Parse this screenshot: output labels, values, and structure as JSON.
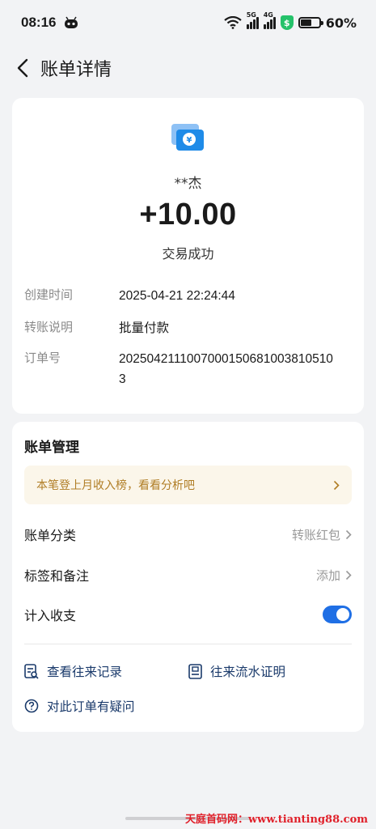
{
  "status_bar": {
    "time": "08:16",
    "sig1_tag": "5G",
    "sig2_tag": "4G",
    "battery_percent": "60%",
    "battery_level": 0.6
  },
  "nav": {
    "title": "账单详情"
  },
  "summary": {
    "icon": "transfer-bill-icon",
    "payee": "**杰",
    "amount": "+10.00",
    "status": "交易成功"
  },
  "details": [
    {
      "label": "创建时间",
      "value": "2025-04-21 22:24:44"
    },
    {
      "label": "转账说明",
      "value": "批量付款"
    },
    {
      "label": "订单号",
      "value": "20250421110070001506810038105103"
    }
  ],
  "management": {
    "title": "账单管理",
    "banner": "本笔登上月收入榜，看看分析吧",
    "category_label": "账单分类",
    "category_value": "转账红包",
    "tags_label": "标签和备注",
    "tags_value": "添加",
    "count_label": "计入收支",
    "count_enabled": true,
    "link_history": "查看往来记录",
    "link_proof": "往来流水证明",
    "link_question": "对此订单有疑问"
  },
  "watermark": "天庭首码网：www.tianting88.com",
  "colors": {
    "accent": "#1f6fe5",
    "banner_text": "#b07d25",
    "banner_bg": "#fbf6ea"
  }
}
